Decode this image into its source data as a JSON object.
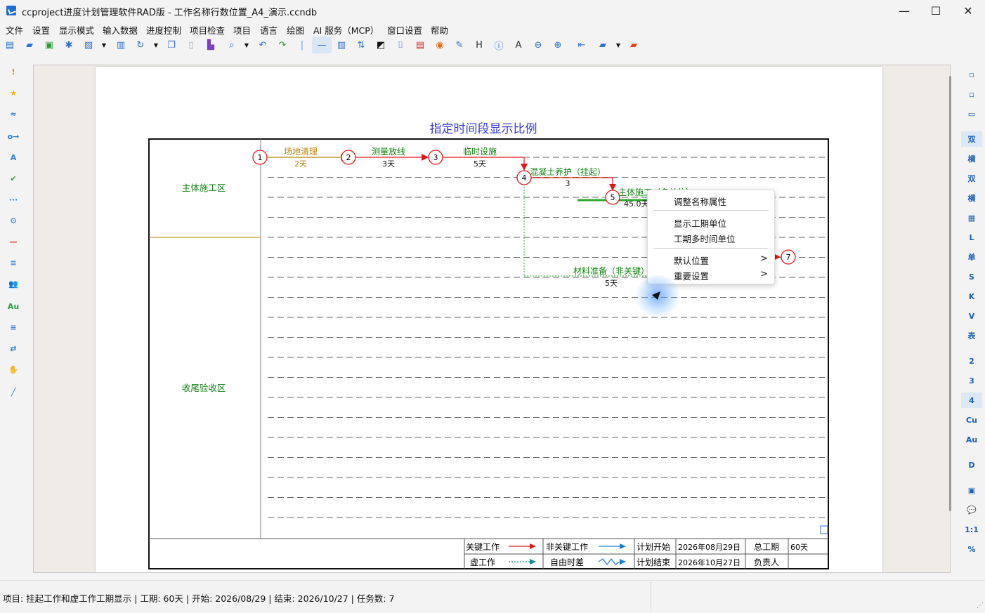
{
  "window": {
    "title": "ccproject进度计划管理软件RAD版 - 工作名称行数位置_A4_演示.ccndb",
    "minimize_glyph": "—",
    "maximize_glyph": "☐",
    "close_glyph": "✕"
  },
  "menu": [
    "文件",
    "设置",
    "显示模式",
    "输入数据",
    "进度控制",
    "项目检查",
    "项目",
    "语言",
    "绘图",
    "AI 服务（MCP）",
    "窗口设置",
    "帮助"
  ],
  "toolbar_icons": [
    "new-file-icon",
    "open-folder-icon",
    "save-icon",
    "snowflake-icon",
    "image-icon",
    "dropdown-arrow-icon",
    "print-icon",
    "refresh-icon",
    "dropdown-arrow-icon",
    "copy-icon",
    "paste-icon",
    "format-brush-icon",
    "zoom-icon",
    "dropdown-arrow-icon",
    "undo-icon",
    "redo-icon",
    "separator-icon",
    "line-mode-icon",
    "column-bars-icon",
    "sort-icon",
    "contrast-icon",
    "paint-roller-icon",
    "layer-icon",
    "palette-icon",
    "edit-icon",
    "heading-icon",
    "info-icon",
    "text-icon",
    "zoom-out-icon",
    "zoom-in-icon",
    "back-icon",
    "folder-icon",
    "dropdown-arrow-icon",
    "red-folder-icon"
  ],
  "left_tools": [
    {
      "icon": "exclamation-icon",
      "glyph": "!",
      "color": "#e08a00"
    },
    {
      "icon": "star-icon",
      "glyph": "★",
      "color": "#f2b600"
    },
    {
      "icon": "wave-icon",
      "glyph": "≈",
      "color": "#2f7fd1"
    },
    {
      "icon": "link-arrow-icon",
      "glyph": "o→",
      "color": "#2f7fd1"
    },
    {
      "icon": "text-style-icon",
      "glyph": "A",
      "color": "#2f7fd1"
    },
    {
      "icon": "check-icon",
      "glyph": "✔",
      "color": "#2ea043"
    },
    {
      "icon": "dots-line-icon",
      "glyph": "···",
      "color": "#2f7fd1"
    },
    {
      "icon": "gear-icon",
      "glyph": "⚙",
      "color": "#2f7fd1"
    },
    {
      "icon": "minus-icon",
      "glyph": "—",
      "color": "#e03030"
    },
    {
      "icon": "sort-lines-icon",
      "glyph": "≡",
      "color": "#2f7fd1"
    },
    {
      "icon": "users-icon",
      "glyph": "👥",
      "color": "#2ea043"
    },
    {
      "icon": "font-size-icon",
      "glyph": "Au",
      "color": "#2ea043"
    },
    {
      "icon": "filter-icon",
      "glyph": "≡",
      "color": "#2f7fd1"
    },
    {
      "icon": "swap-icon",
      "glyph": "⇄",
      "color": "#2f7fd1"
    },
    {
      "icon": "hand-icon",
      "glyph": "✋",
      "color": "#333333"
    },
    {
      "icon": "pen-icon",
      "glyph": "╱",
      "color": "#2f7fd1"
    }
  ],
  "right_tools": [
    {
      "icon": "panel-left-icon",
      "glyph": "▫"
    },
    {
      "icon": "panel-right-icon",
      "glyph": "▫"
    },
    {
      "icon": "panel-bottom-icon",
      "glyph": "▭"
    },
    {
      "icon": "double-text-icon",
      "glyph": "双"
    },
    {
      "icon": "horizontal-text-icon",
      "glyph": "横"
    },
    {
      "icon": "double-hot-icon",
      "glyph": "双"
    },
    {
      "icon": "horizontal-hot-icon",
      "glyph": "横"
    },
    {
      "icon": "table-icon",
      "glyph": "▦"
    },
    {
      "icon": "letter-l-icon",
      "glyph": "L"
    },
    {
      "icon": "single-text-icon",
      "glyph": "单"
    },
    {
      "icon": "letter-s-icon",
      "glyph": "S"
    },
    {
      "icon": "letter-k-icon",
      "glyph": "K"
    },
    {
      "icon": "letter-v-icon",
      "glyph": "V"
    },
    {
      "icon": "table-text-icon",
      "glyph": "表"
    },
    {
      "icon": "number-2-icon",
      "glyph": "2"
    },
    {
      "icon": "number-3-icon",
      "glyph": "3"
    },
    {
      "icon": "number-4-icon",
      "glyph": "4"
    },
    {
      "icon": "cu-icon",
      "glyph": "Cu"
    },
    {
      "icon": "au-icon",
      "glyph": "Au"
    },
    {
      "icon": "letter-d-icon",
      "glyph": "D"
    },
    {
      "icon": "frame-icon",
      "glyph": "▣"
    },
    {
      "icon": "comment-icon",
      "glyph": "💬"
    },
    {
      "icon": "scale-icon",
      "glyph": "1:1"
    },
    {
      "icon": "percent-icon",
      "glyph": "%"
    }
  ],
  "chart": {
    "title": "指定时间段显示比例",
    "zones": [
      "主体施工区",
      "收尾验收区"
    ],
    "nodes": [
      "1",
      "2",
      "3",
      "4",
      "5",
      "7"
    ],
    "tasks": [
      {
        "name": "场地清理",
        "duration": "2天",
        "color": "#b8860b"
      },
      {
        "name": "测量放线",
        "duration": "3天",
        "color": "#128212"
      },
      {
        "name": "临时设施",
        "duration": "5天",
        "color": "#128212"
      },
      {
        "name": "混凝土养护（挂起）",
        "duration": "3",
        "color": "#128212"
      },
      {
        "name": "主体施工（多单位）",
        "duration": "45.0天",
        "color": "#128212"
      },
      {
        "name": "材料准备（非关键）",
        "duration": "5天",
        "color": "#128212"
      }
    ],
    "legend": {
      "critical": "关键工作",
      "noncritical": "非关键工作",
      "plan_start_label": "计划开始",
      "plan_start": "2026年08月29日",
      "total_label": "总工期",
      "total": "60天",
      "dummy": "虚工作",
      "free_float": "自由时差",
      "plan_end_label": "计划结束",
      "plan_end": "2026年10月27日",
      "owner_label": "负责人",
      "owner": ""
    }
  },
  "context_menu": {
    "items": [
      "调整名称属性",
      "显示工期单位",
      "工期多时间单位",
      "默认位置",
      "重要设置"
    ],
    "submenu_arrow": ">"
  },
  "status": {
    "text": "项目: 挂起工作和虚工作工期显示 | 工期: 60天 | 开始: 2026/08/29 | 结束: 2026/10/27 | 任务数: 7"
  },
  "colors": {
    "critical": "#e01818",
    "noncritical": "#1e7fd6",
    "label_green": "#128212",
    "title_blue": "#3a3ad8",
    "zone_border": "#b8860b"
  }
}
